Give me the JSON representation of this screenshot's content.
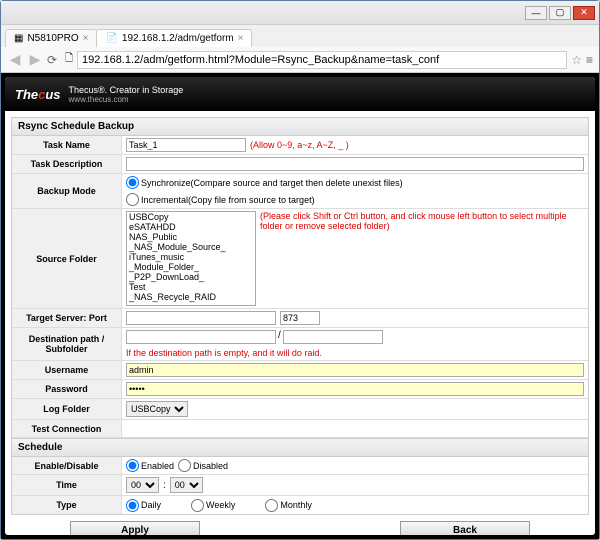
{
  "window": {
    "tab1": "N5810PRO",
    "tab2": "192.168.1.2/adm/getform"
  },
  "addr": "192.168.1.2/adm/getform.html?Module=Rsync_Backup&name=task_conf",
  "brand": {
    "name": "Thecus",
    "tag": "Thecus®. Creator in Storage",
    "site": "www.thecus.com"
  },
  "panel": {
    "title": "Rsync Schedule Backup"
  },
  "fields": {
    "task_name_label": "Task Name",
    "task_name_value": "Task_1",
    "task_name_hint": "(Allow 0~9, a~z, A~Z, _ )",
    "task_desc_label": "Task Description",
    "task_desc_value": "",
    "backup_mode_label": "Backup Mode",
    "backup_mode_opt1": "Synchronize(Compare source and target then delete unexist files)",
    "backup_mode_opt2": "Incremental(Copy file from source to target)",
    "source_folder_label": "Source Folder",
    "source_hint": "(Please click Shift or Ctrl button, and click mouse left button to select multiple folder or remove selected folder)",
    "target_label": "Target Server: Port",
    "port_value": "873",
    "dest_label": "Destination path / Subfolder",
    "dest_hint": "If the destination path is empty, and it will do raid.",
    "user_label": "Username",
    "user_value": "admin",
    "pass_label": "Password",
    "pass_value": "•••••",
    "log_label": "Log Folder",
    "log_value": "USBCopy",
    "test_label": "Test Connection"
  },
  "source_items": [
    "USBCopy",
    "eSATAHDD",
    "NAS_Public",
    "_NAS_Module_Source_",
    "iTunes_music",
    "_Module_Folder_",
    "_P2P_DownLoad_",
    "Test",
    "_NAS_Recycle_RAID"
  ],
  "schedule": {
    "title": "Schedule",
    "enable_label": "Enable/Disable",
    "enabled": "Enabled",
    "disabled": "Disabled",
    "time_label": "Time",
    "hour": "00",
    "minute": "00",
    "type_label": "Type",
    "daily": "Daily",
    "weekly": "Weekly",
    "monthly": "Monthly"
  },
  "buttons": {
    "apply": "Apply",
    "back": "Back"
  }
}
